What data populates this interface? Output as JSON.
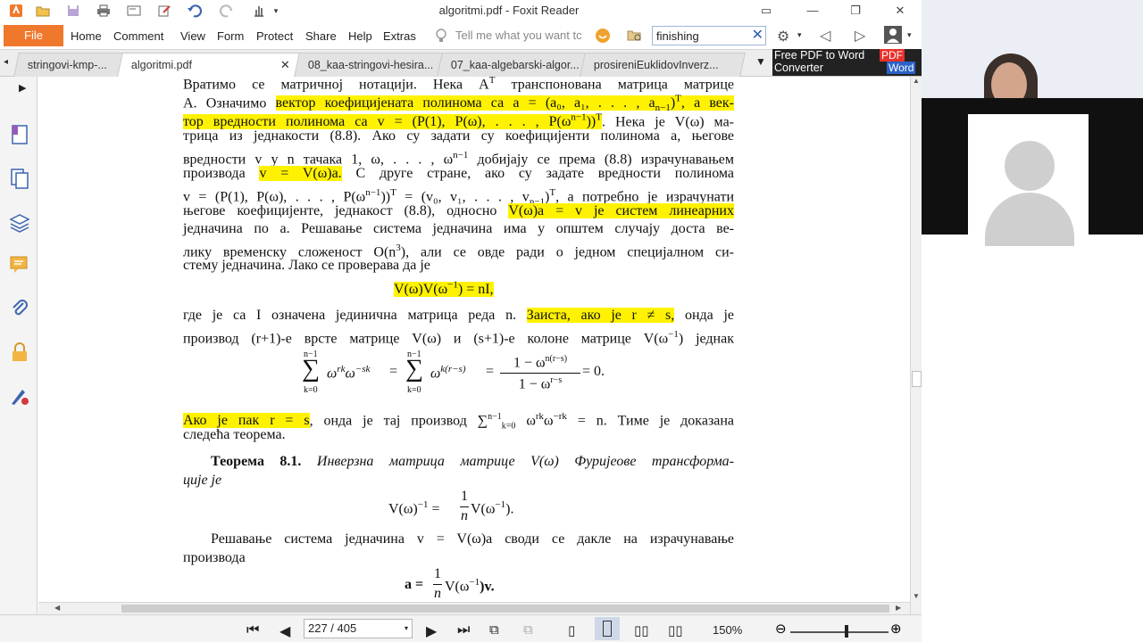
{
  "window": {
    "title": "algoritmi.pdf - Foxit Reader"
  },
  "menu": {
    "file": "File",
    "items": [
      "Home",
      "Comment",
      "View",
      "Form",
      "Protect",
      "Share",
      "Help",
      "Extras"
    ],
    "tell_me": "Tell me what you want tc",
    "search_value": "finishing"
  },
  "tabs": [
    {
      "label": "stringovi-kmp-...",
      "active": false
    },
    {
      "label": "algoritmi.pdf",
      "active": true
    },
    {
      "label": "08_kaa-stringovi-hesira...",
      "active": false
    },
    {
      "label": "07_kaa-algebarski-algor...",
      "active": false
    },
    {
      "label": "prosireniEuklidovInverz...",
      "active": false
    }
  ],
  "ad": {
    "line1": "Free PDF to Word",
    "line2": "Converter",
    "pdf": "PDF",
    "word": "Word"
  },
  "status": {
    "page": "227 / 405",
    "zoom": "150%"
  },
  "document": {
    "l1": "Вратимо се матричној нотацији. Нека A",
    "l1_sup": "T",
    "l1b": " транспонована матрица матрице",
    "l2a": "A. Означимо ",
    "l2_hl": "вектор коефицијената полинома са a = (a₀, a₁, . . . , a",
    "l2_sub": "n−1",
    "l2_hl2": ")",
    "l2_sup": "T",
    "l2_hl3": ", а век-",
    "l3_hl": "тор вредности полинома са v = (P(1), P(ω), . . . , P(ω",
    "l3_sup": "n−1",
    "l3_hl2": "))",
    "l3_sup2": "T",
    "l3b": ". Нека је V(ω) ма-",
    "l4": "трица из једнакости (8.8). Ако су задати су коефицијенти полинома a, његове",
    "l5": "вредности v у n тачака 1, ω, . . . , ω",
    "l5_sup": "n−1",
    "l5b": " добијају се према (8.8) израчунавањем",
    "l6a": "производа ",
    "l6_hl": "v = V(ω)a.",
    "l6b": " С друге стране, ако су задате вредности полинома",
    "l7": "v = (P(1), P(ω), . . . , P(ω",
    "l7_sup": "n−1",
    "l7b": "))",
    "l7_sup2": "T",
    "l7c": " = (v₀, v₁, . . . , v",
    "l7_sub": "n−1",
    "l7d": ")",
    "l7_sup3": "T",
    "l7e": ", а потребно је израчунати",
    "l8a": "његове коефицијенте, једнакост (8.8), односно ",
    "l8_hl": "V(ω)a = v је систем линеарних",
    "l9": "једначина по a. Решавање система једначина има у општем случају доста ве-",
    "l10": "лику временску сложеност O(n",
    "l10_sup": "3",
    "l10b": "), али се овде ради о једном специјалном си-",
    "l11": "стему једначина. Лако се проверава да је",
    "eq1": "V(ω)V(ω",
    "eq1_sup": "−1",
    "eq1b": ") = nI,",
    "l12a": "где је са I означена јединична матрица реда n. ",
    "l12_hl": "Заиста, ако је r ≠ s,",
    "l12b": " онда је",
    "l13": "производ (r+1)-е врсте матрице V(ω) и (s+1)-е колоне матрице V(ω",
    "l13_sup": "−1",
    "l13b": ") једнак",
    "eq2_sum1_top": "n−1",
    "eq2_sum1_bot": "k=0",
    "eq2_a": "ω",
    "eq2_a_sup": "rk",
    "eq2_b": "ω",
    "eq2_b_sup": "−sk",
    "eq2_eq": "=",
    "eq2_sum2_top": "n−1",
    "eq2_sum2_bot": "k=0",
    "eq2_c": "ω",
    "eq2_c_sup": "k(r−s)",
    "eq2_frac_num": "1 − ω",
    "eq2_frac_num_sup": "n(r−s)",
    "eq2_frac_den": "1 − ω",
    "eq2_frac_den_sup": "r−s",
    "eq2_end": "= 0.",
    "l14_hl": "Ако је пак r = s",
    "l14a": ", онда је тај производ ",
    "l14_sum": "∑",
    "l14_sum_sup": "n−1",
    "l14_sum_sub": "k=0",
    "l14b": " ω",
    "l14b_sup": "rk",
    "l14c": "ω",
    "l14c_sup": "−rk",
    "l14d": " = n. Тиме је доказана",
    "l15": "следећа теорема.",
    "thm_label": "Теорема 8.1.",
    "thm_text": " Инверзна матрица матрице V(ω) Фуријеове трансформа-",
    "thm_text2": "ције је",
    "eq3a": "V(ω)",
    "eq3a_sup": "−1",
    "eq3b": " = ",
    "eq3_num": "1",
    "eq3_den": "n",
    "eq3c": "V(ω",
    "eq3c_sup": "−1",
    "eq3d": ").",
    "l16": "Решавање система једначина v = V(ω)a своди се дакле на израчунавање",
    "l17": "производа",
    "eq4a": "a = ",
    "eq4_num": "1",
    "eq4_den": "n",
    "eq4b": "V(ω",
    "eq4b_sup": "−1",
    "eq4c": ")v."
  },
  "colors": {
    "accent": "#f0782c",
    "highlight": "#fff200"
  }
}
